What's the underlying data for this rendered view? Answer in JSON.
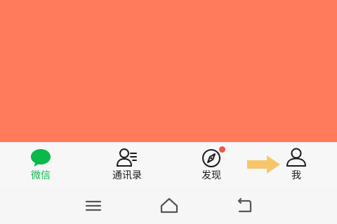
{
  "colors": {
    "content_background": "#ff7b5b",
    "tabbar_background": "#f7f7f7",
    "active_tab": "#09b94a",
    "inactive_icon": "#1a1a1a",
    "badge": "#f0544d",
    "arrow": "#f5c66a",
    "nav_icon": "#555555"
  },
  "tabbar": {
    "tabs": [
      {
        "label": "微信",
        "icon": "chat-bubble-icon",
        "active": true
      },
      {
        "label": "通讯录",
        "icon": "contacts-icon",
        "active": false
      },
      {
        "label": "发现",
        "icon": "compass-icon",
        "active": false,
        "badge": "red-dot"
      },
      {
        "label": "我",
        "icon": "person-icon",
        "active": false
      }
    ]
  },
  "annotation": {
    "icon": "arrow-right-icon",
    "points_to": "我"
  },
  "navbar": {
    "buttons": [
      {
        "icon": "menu-icon"
      },
      {
        "icon": "home-icon"
      },
      {
        "icon": "back-icon"
      }
    ]
  }
}
